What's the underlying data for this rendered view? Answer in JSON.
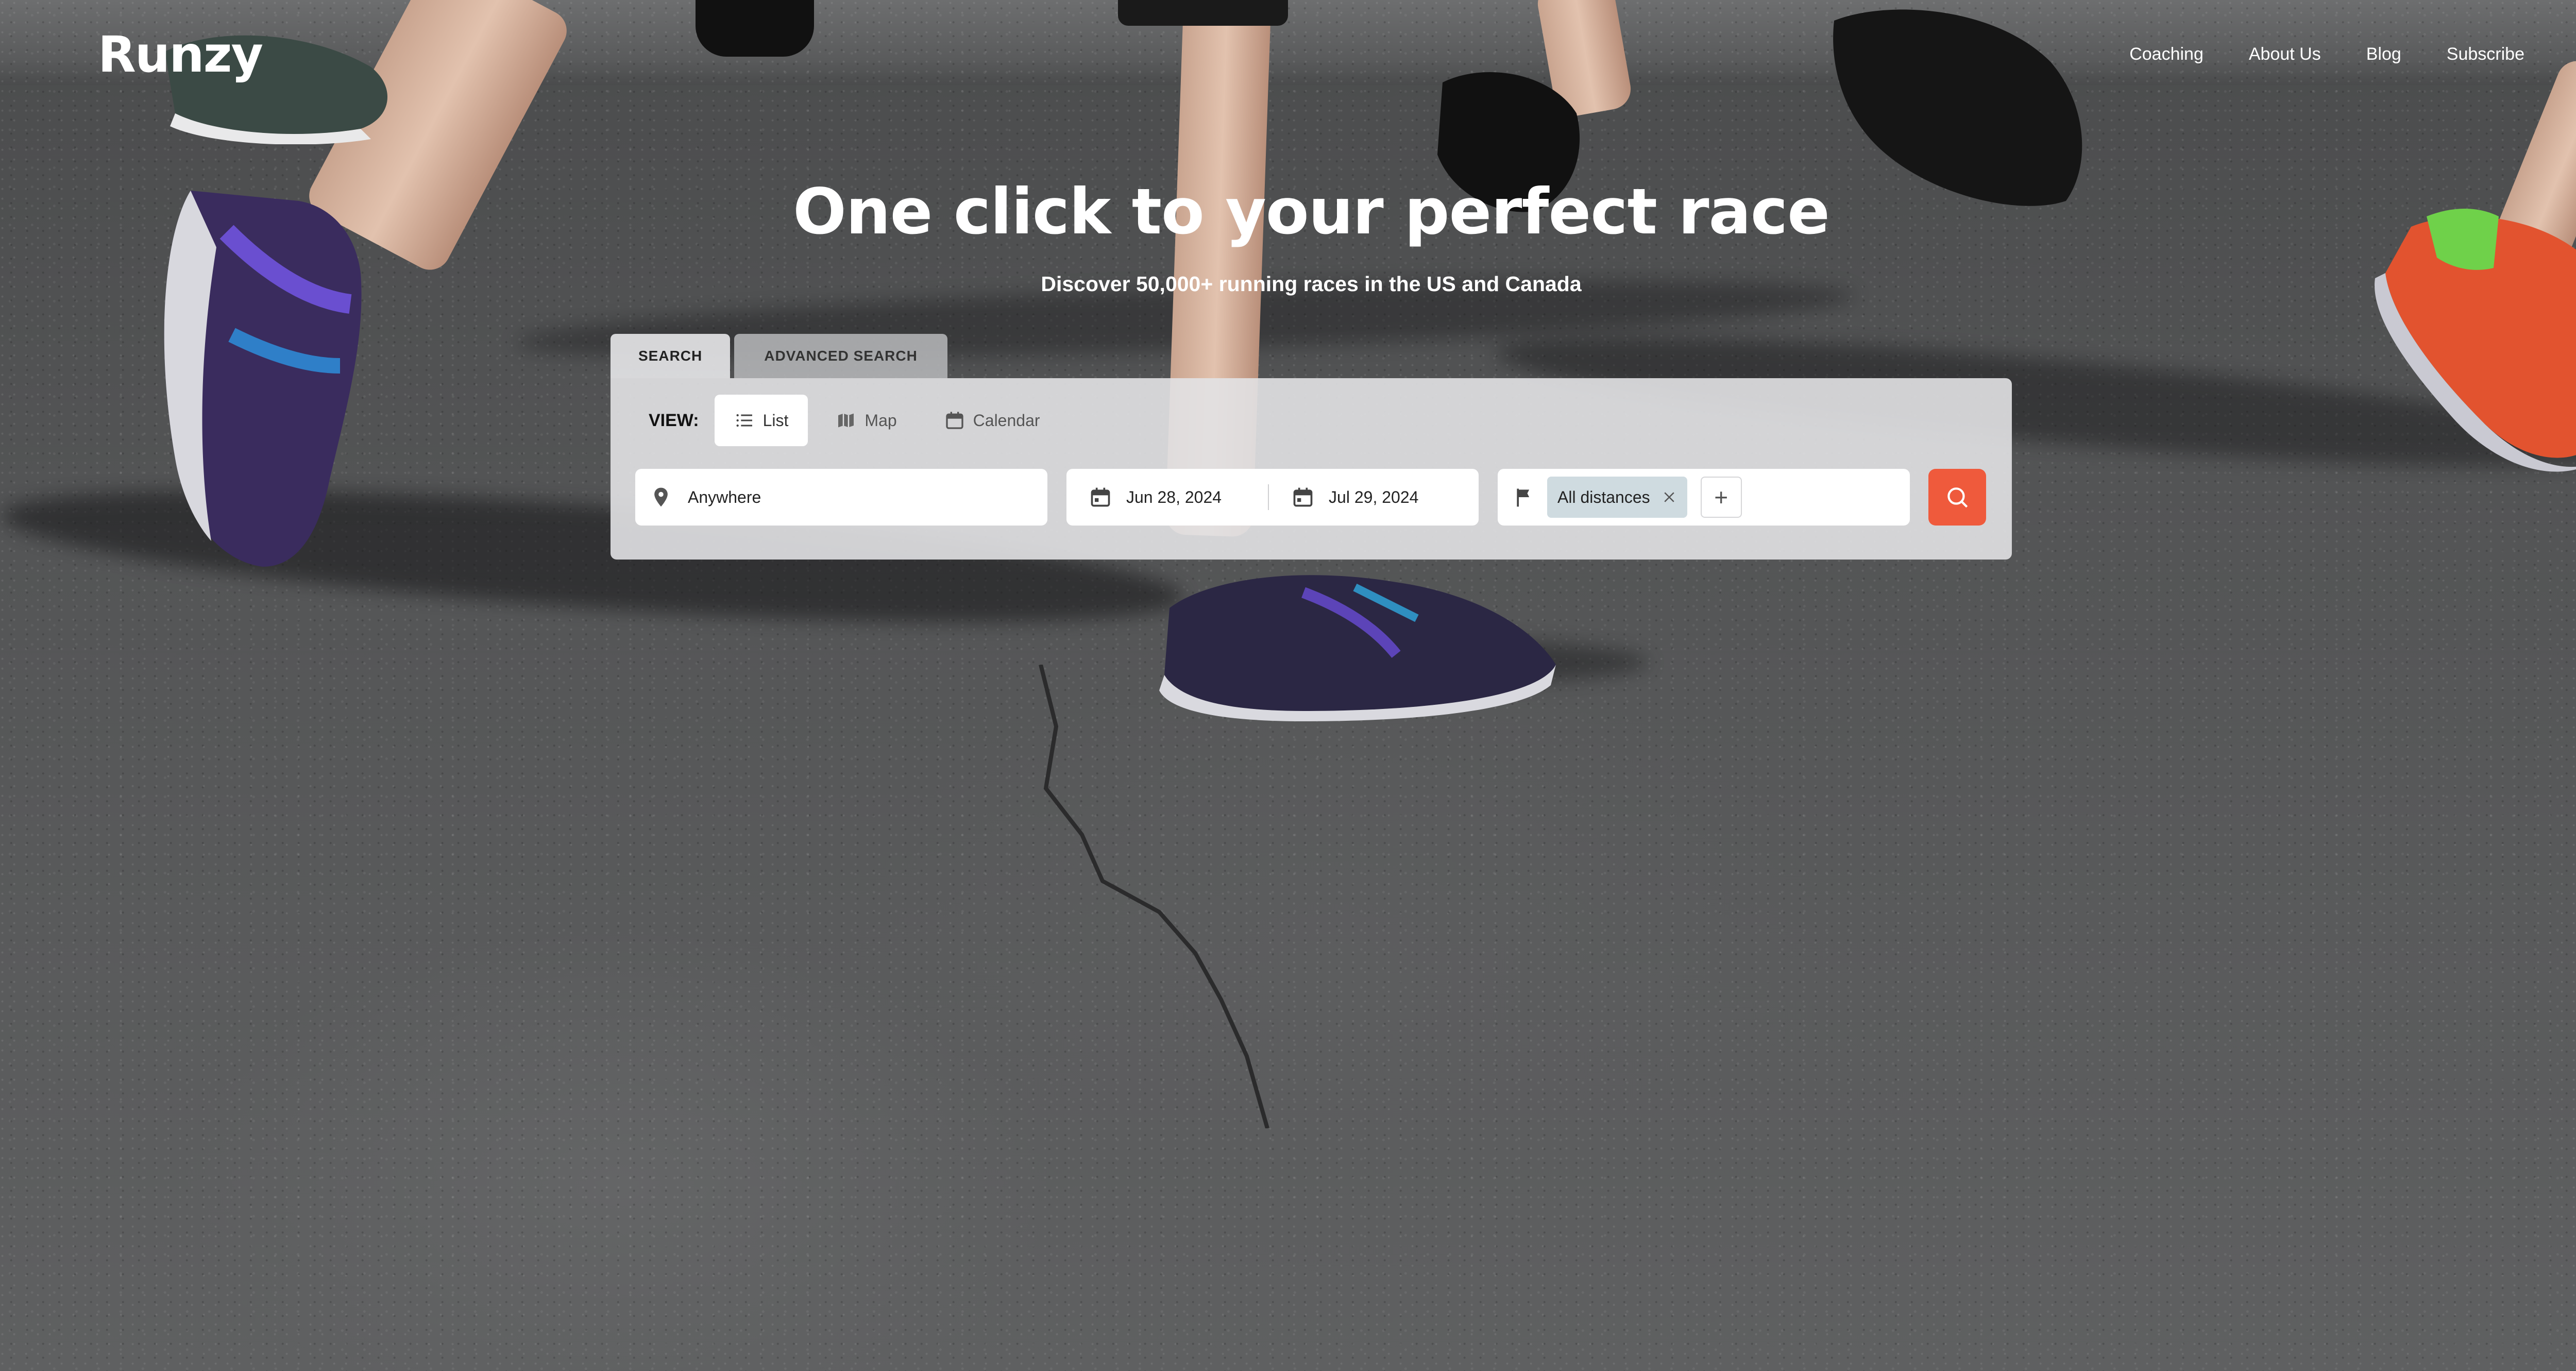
{
  "brand": {
    "logo_text": "Runzy"
  },
  "nav": {
    "items": [
      {
        "label": "Coaching"
      },
      {
        "label": "About Us"
      },
      {
        "label": "Blog"
      },
      {
        "label": "Subscribe"
      }
    ]
  },
  "hero": {
    "title": "One click to your perfect race",
    "subtitle": "Discover 50,000+ running races in the US and Canada"
  },
  "search": {
    "tabs": [
      {
        "label": "SEARCH",
        "active": true
      },
      {
        "label": "ADVANCED SEARCH",
        "active": false
      }
    ],
    "view_label": "VIEW:",
    "view_options": [
      {
        "label": "List",
        "icon": "list-icon",
        "selected": true
      },
      {
        "label": "Map",
        "icon": "map-icon",
        "selected": false
      },
      {
        "label": "Calendar",
        "icon": "calendar-icon",
        "selected": false
      }
    ],
    "location": {
      "value": "Anywhere",
      "icon": "location-pin-icon"
    },
    "date_start": {
      "value": "Jun 28, 2024",
      "icon": "calendar-icon"
    },
    "date_end": {
      "value": "Jul 29, 2024",
      "icon": "calendar-icon"
    },
    "distance": {
      "chip_label": "All distances",
      "icon": "flag-icon",
      "add_label": "+"
    },
    "submit_icon": "search-icon"
  },
  "colors": {
    "accent": "#ef5a3c",
    "chip_bg": "#cfdbe0",
    "panel_bg": "#e2e2e4"
  }
}
